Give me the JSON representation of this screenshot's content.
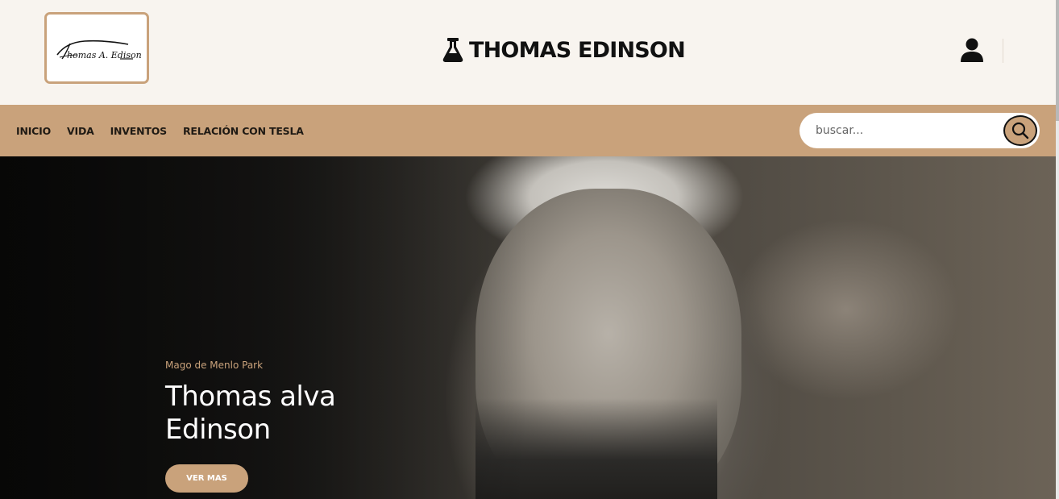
{
  "header": {
    "logo_signature": "Thomas A. Edison",
    "brand_icon": "flask-icon",
    "brand_title": "THOMAS EDINSON",
    "user_icon": "user-icon"
  },
  "nav": {
    "items": [
      {
        "label": "INICIO"
      },
      {
        "label": "VIDA"
      },
      {
        "label": "INVENTOS"
      },
      {
        "label": "RELACIÓN CON TESLA"
      }
    ]
  },
  "search": {
    "placeholder": "buscar...",
    "value": "",
    "icon": "search-icon"
  },
  "hero": {
    "subtitle": "Mago de Menlo Park",
    "title": "Thomas alva Edinson",
    "button_label": "VER MAS"
  },
  "colors": {
    "accent": "#c9a27b",
    "header_bg": "#f8f4ef",
    "text_dark": "#111111"
  }
}
